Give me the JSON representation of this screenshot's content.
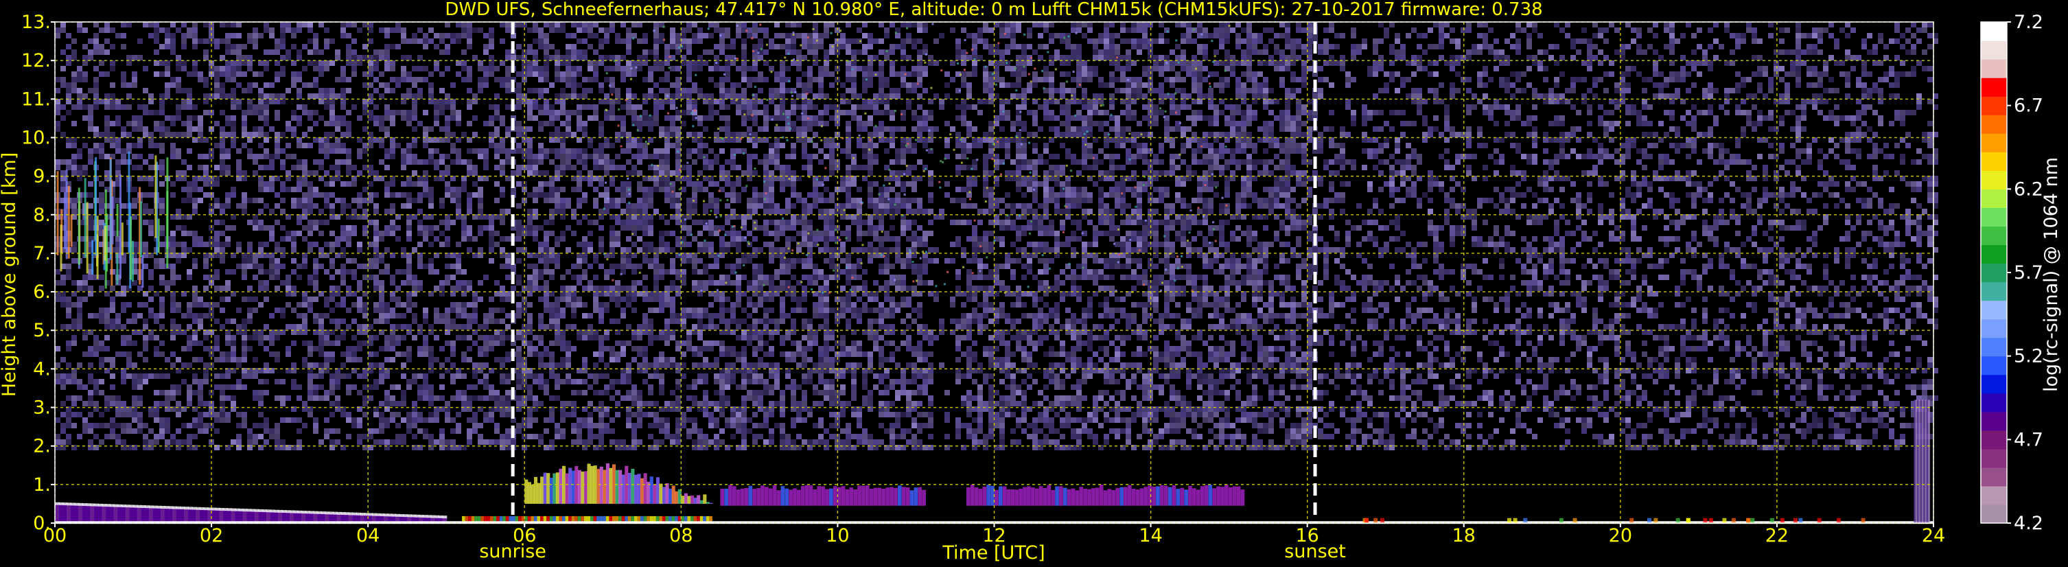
{
  "chart_data": {
    "type": "heatmap",
    "title": "DWD UFS, Schneefernerhaus; 47.417° N 10.980° E, altitude: 0 m    Lufft CHM15k (CHM15kUFS): 27-10-2017    firmware: 0.738",
    "xlabel": "Time [UTC]",
    "ylabel": "Height above ground [km]",
    "xlim": [
      0,
      24
    ],
    "ylim": [
      0,
      13
    ],
    "x_ticks": [
      "00",
      "02",
      "04",
      "06",
      "08",
      "10",
      "12",
      "14",
      "16",
      "18",
      "20",
      "22",
      "24"
    ],
    "y_ticks": [
      "0.",
      "1.",
      "2.",
      "3.",
      "4.",
      "5.",
      "6.",
      "7.",
      "8.",
      "9.",
      "10.",
      "11.",
      "12.",
      "13."
    ],
    "grid": true,
    "events": [
      {
        "label": "sunrise",
        "x": 5.85
      },
      {
        "label": "sunset",
        "x": 16.1
      }
    ],
    "colorbar": {
      "label": "log(rc-signal) @ 1064 nm",
      "min": 4.2,
      "max": 7.2,
      "ticks": [
        "7.2",
        "6.7",
        "6.2",
        "5.7",
        "5.2",
        "4.7",
        "4.2"
      ],
      "colors": [
        "#a890a8",
        "#b898b0",
        "#98508a",
        "#8a3080",
        "#7a1878",
        "#5a0090",
        "#2a00b8",
        "#0018e0",
        "#2858ff",
        "#5080ff",
        "#7aa0ff",
        "#98b8ff",
        "#40b0a0",
        "#20a060",
        "#10a020",
        "#40c040",
        "#70e060",
        "#b0f040",
        "#e8f020",
        "#ffd000",
        "#ffa000",
        "#ff7000",
        "#ff3800",
        "#ff0000",
        "#e8c0c0",
        "#f0e0e0",
        "#ffffff"
      ]
    }
  }
}
